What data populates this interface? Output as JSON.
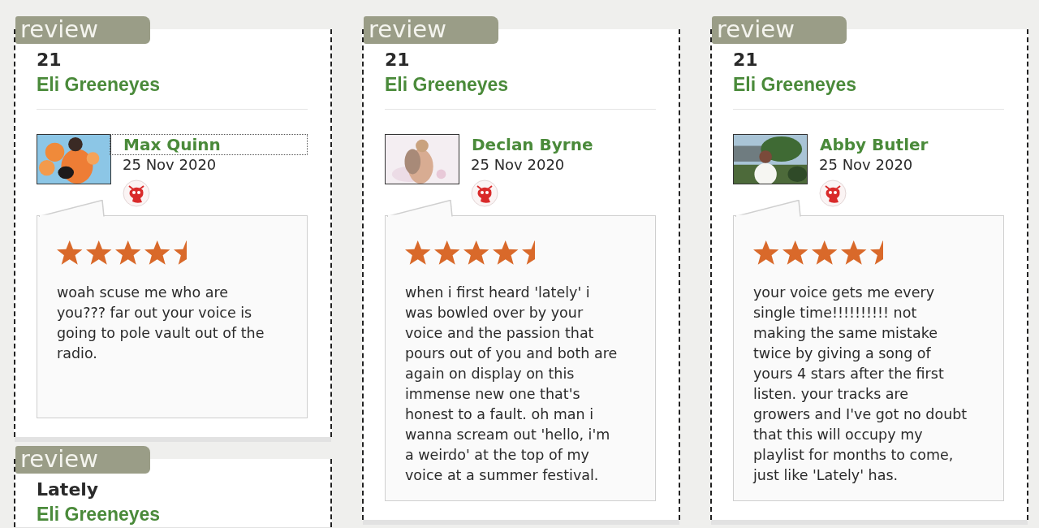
{
  "columns": [
    {
      "cards": [
        {
          "tab": "review",
          "title": "21",
          "artist": "Eli Greeneyes",
          "reviewer": "Max Quinn",
          "date": "25 Nov 2020",
          "focused": true,
          "stars": 4.5,
          "text": "woah scuse me who are you??? far out your voice is going to pole vault out of the radio."
        },
        {
          "tab": "review",
          "title": "Lately",
          "artist": "Eli Greeneyes"
        }
      ]
    },
    {
      "cards": [
        {
          "tab": "review",
          "title": "21",
          "artist": "Eli Greeneyes",
          "reviewer": "Declan Byrne",
          "date": "25 Nov 2020",
          "focused": false,
          "stars": 4.5,
          "text": "when i first heard 'lately' i was bowled over by your voice and the passion that pours out of you and both are again on display on this immense new one that's honest to a fault. oh man i wanna scream out 'hello, i'm a weirdo' at the top of my voice at a summer festival."
        }
      ]
    },
    {
      "cards": [
        {
          "tab": "review",
          "title": "21",
          "artist": "Eli Greeneyes",
          "reviewer": "Abby Butler",
          "date": "25 Nov 2020",
          "focused": false,
          "stars": 4.5,
          "text": "your voice gets me every single time!!!!!!!!!! not making the same mistake twice by giving a song of yours 4 stars after the first listen. your tracks are growers and I've got no doubt that this will occupy my playlist for months to come, just like 'Lately' has."
        }
      ]
    }
  ]
}
